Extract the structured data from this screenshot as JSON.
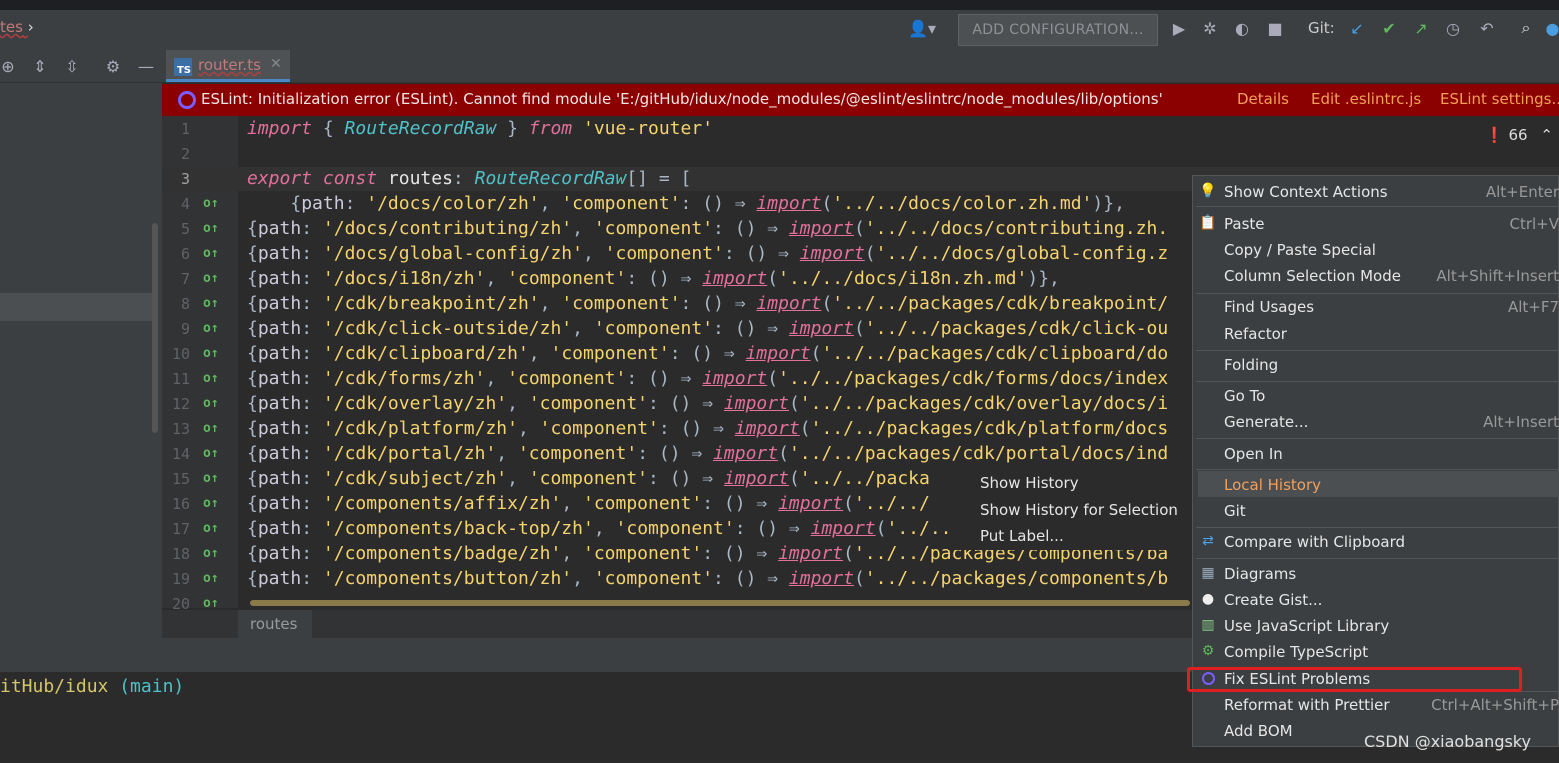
{
  "toolbar": {
    "breadcrumb": "tes",
    "add_configuration": "ADD CONFIGURATION...",
    "git_label": "Git:"
  },
  "tab": {
    "label": "router.ts",
    "icon_text": "TS"
  },
  "banner": {
    "text": "ESLint: Initialization error (ESLint). Cannot find module 'E:/gitHub/idux/node_modules/@eslint/eslintrc/node_modules/lib/options'",
    "details": "Details",
    "edit": "Edit .eslintrc.js",
    "settings": "ESLint settings..."
  },
  "problems_count": "66",
  "line_numbers": [
    "1",
    "2",
    "3",
    "4",
    "5",
    "6",
    "7",
    "8",
    "9",
    "10",
    "11",
    "12",
    "13",
    "14",
    "15",
    "16",
    "17",
    "18",
    "19",
    "20"
  ],
  "code": {
    "l1": {
      "kw1": "import",
      "p1": " { ",
      "ty": "RouteRecordRaw",
      "p2": " } ",
      "kw2": "from",
      "sp": " ",
      "st": "'vue-router'"
    },
    "l3": {
      "kw1": "export",
      "sp1": " ",
      "kw2": "const",
      "id": " routes",
      "p1": ": ",
      "ty": "RouteRecordRaw",
      "p2": "[] = ["
    },
    "rows": [
      {
        "indent": "    ",
        "path": "'/docs/color/zh'",
        "imp": "'../../docs/color.zh.md'",
        "tail": ")},"
      },
      {
        "indent": "",
        "path": "'/docs/contributing/zh'",
        "imp": "'../../docs/contributing.zh.",
        "tail": ""
      },
      {
        "indent": "",
        "path": "'/docs/global-config/zh'",
        "imp": "'../../docs/global-config.z",
        "tail": ""
      },
      {
        "indent": "",
        "path": "'/docs/i18n/zh'",
        "imp": "'../../docs/i18n.zh.md'",
        "tail": ")},"
      },
      {
        "indent": "",
        "path": "'/cdk/breakpoint/zh'",
        "imp": "'../../packages/cdk/breakpoint/",
        "tail": ""
      },
      {
        "indent": "",
        "path": "'/cdk/click-outside/zh'",
        "imp": "'../../packages/cdk/click-ou",
        "tail": ""
      },
      {
        "indent": "",
        "path": "'/cdk/clipboard/zh'",
        "imp": "'../../packages/cdk/clipboard/do",
        "tail": ""
      },
      {
        "indent": "",
        "path": "'/cdk/forms/zh'",
        "imp": "'../../packages/cdk/forms/docs/index",
        "tail": ""
      },
      {
        "indent": "",
        "path": "'/cdk/overlay/zh'",
        "imp": "'../../packages/cdk/overlay/docs/i",
        "tail": ""
      },
      {
        "indent": "",
        "path": "'/cdk/platform/zh'",
        "imp": "'../../packages/cdk/platform/docs",
        "tail": ""
      },
      {
        "indent": "",
        "path": "'/cdk/portal/zh'",
        "imp": "'../../packages/cdk/portal/docs/ind",
        "tail": ""
      },
      {
        "indent": "",
        "path": "'/cdk/subject/zh'",
        "imp": "'../../packa",
        "tail": ""
      },
      {
        "indent": "",
        "path": "'/components/affix/zh'",
        "imp": "'../../",
        "tail": ""
      },
      {
        "indent": "",
        "path": "'/components/back-top/zh'",
        "imp": "'../../",
        "tail": ""
      },
      {
        "indent": "",
        "path": "'/components/badge/zh'",
        "imp": "'../../packages/components/ba",
        "tail": ""
      },
      {
        "indent": "",
        "path": "'/components/button/zh'",
        "imp": "'../../packages/components/b",
        "tail": ""
      }
    ],
    "path_key": "path",
    "component_key": "'component'",
    "arrow": "() ⇒ ",
    "import_kw": "import"
  },
  "crumb": "routes",
  "terminal_prefix": "itHub/idux ",
  "terminal_branch": "(main)",
  "submenu": [
    "Show History",
    "Show History for Selection",
    "Put Label..."
  ],
  "context_menu": {
    "items": [
      {
        "label": "Show Context Actions",
        "shortcut": "Alt+Enter"
      },
      {
        "label": "Paste",
        "shortcut": "Ctrl+V"
      },
      {
        "label": "Copy / Paste Special",
        "shortcut": ""
      },
      {
        "label": "Column Selection Mode",
        "shortcut": "Alt+Shift+Insert"
      },
      {
        "label": "Find Usages",
        "shortcut": "Alt+F7"
      },
      {
        "label": "Refactor",
        "shortcut": ""
      },
      {
        "label": "Folding",
        "shortcut": ""
      },
      {
        "label": "Go To",
        "shortcut": ""
      },
      {
        "label": "Generate...",
        "shortcut": "Alt+Insert"
      },
      {
        "label": "Open In",
        "shortcut": ""
      },
      {
        "label": "Local History",
        "shortcut": ""
      },
      {
        "label": "Git",
        "shortcut": ""
      },
      {
        "label": "Compare with Clipboard",
        "shortcut": ""
      },
      {
        "label": "Diagrams",
        "shortcut": ""
      },
      {
        "label": "Create Gist...",
        "shortcut": ""
      },
      {
        "label": "Use JavaScript Library",
        "shortcut": ""
      },
      {
        "label": "Compile TypeScript",
        "shortcut": ""
      },
      {
        "label": "Fix ESLint Problems",
        "shortcut": ""
      },
      {
        "label": "Reformat with Prettier",
        "shortcut": "Ctrl+Alt+Shift+P"
      },
      {
        "label": "Add BOM",
        "shortcut": ""
      }
    ]
  },
  "watermark": "CSDN @xiaobangsky",
  "colors": {
    "banner": "#8b0000",
    "keyword": "#e1709a",
    "string": "#f5d36e",
    "type": "#4fc1c8",
    "highlight_box": "#e02020"
  }
}
